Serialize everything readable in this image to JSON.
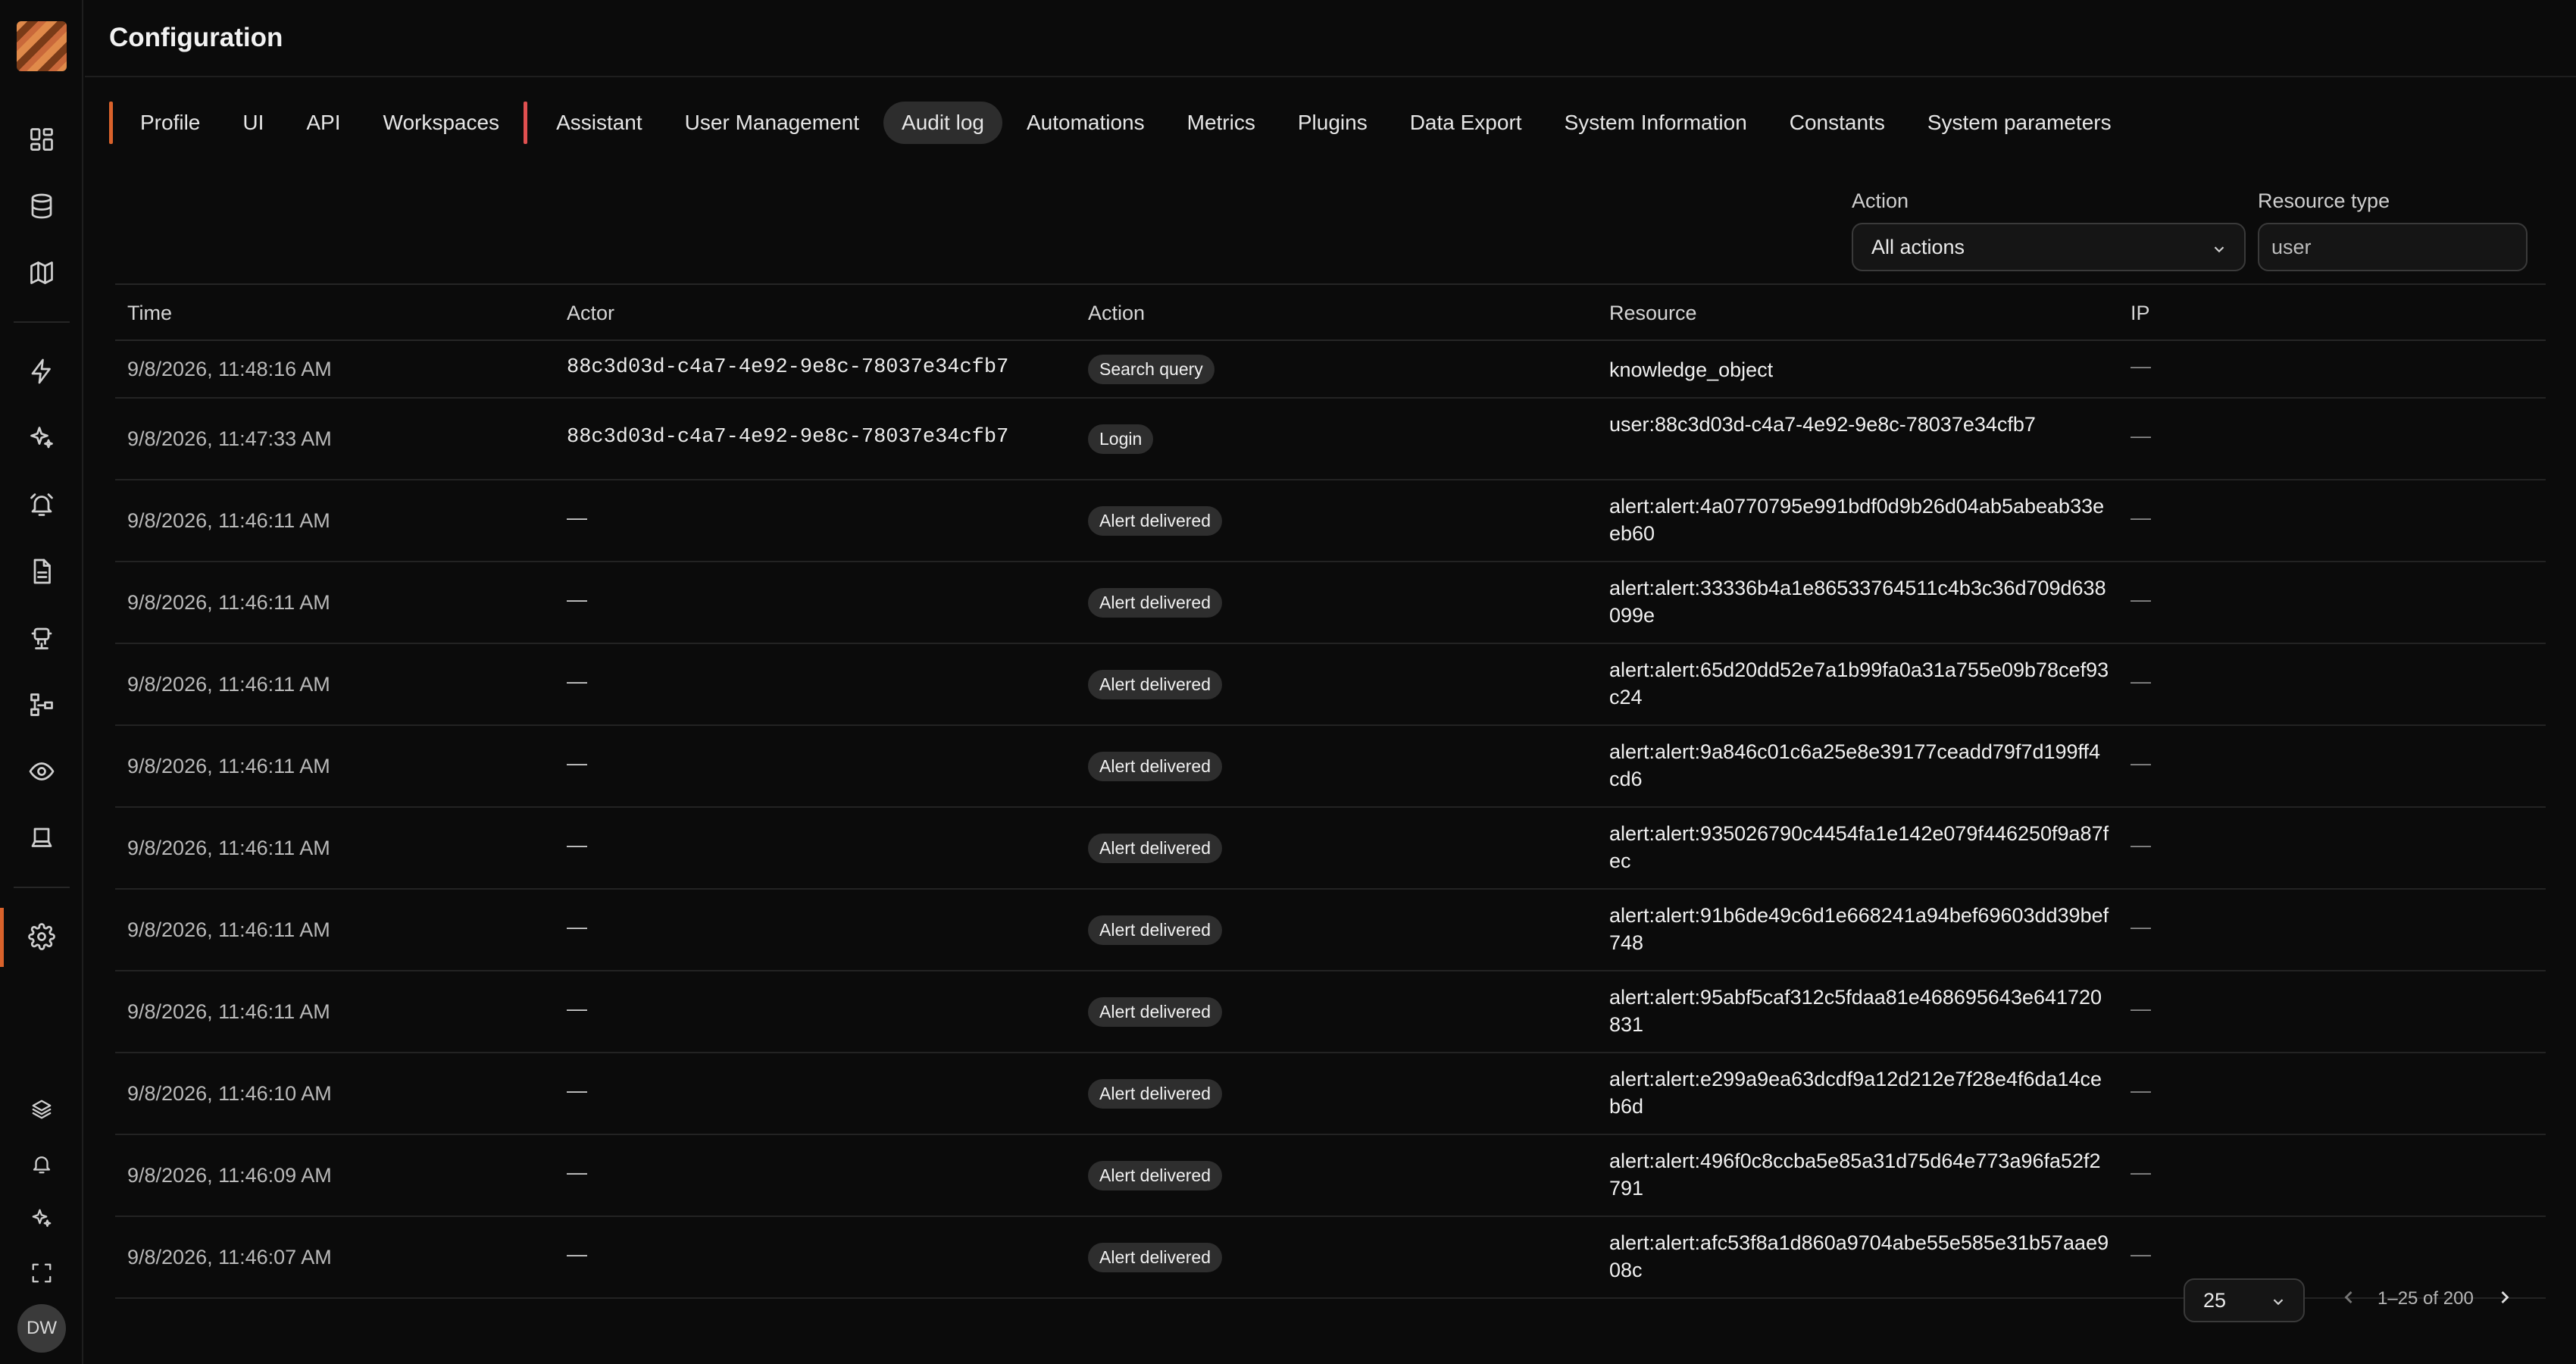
{
  "header": {
    "title": "Configuration"
  },
  "tabs": [
    {
      "label": "Profile"
    },
    {
      "label": "UI"
    },
    {
      "label": "API"
    },
    {
      "label": "Workspaces"
    },
    {
      "label": "Assistant"
    },
    {
      "label": "User Management"
    },
    {
      "label": "Audit log"
    },
    {
      "label": "Automations"
    },
    {
      "label": "Metrics"
    },
    {
      "label": "Plugins"
    },
    {
      "label": "Data Export"
    },
    {
      "label": "System Information"
    },
    {
      "label": "Constants"
    },
    {
      "label": "System parameters"
    }
  ],
  "active_tab": "Audit log",
  "filters": {
    "action_label": "Action",
    "action_value": "All actions",
    "resource_label": "Resource type",
    "resource_value": "user"
  },
  "table": {
    "headers": [
      "Time",
      "Actor",
      "Action",
      "Resource",
      "IP"
    ],
    "rows": [
      {
        "time": "9/8/2026, 11:48:16 AM",
        "actor": "88c3d03d-c4a7-4e92-9e8c-78037e34cfb7",
        "action": "Search query",
        "resource": "knowledge_object",
        "ip": "—"
      },
      {
        "time": "9/8/2026, 11:47:33 AM",
        "actor": "88c3d03d-c4a7-4e92-9e8c-78037e34cfb7",
        "action": "Login",
        "resource": "user:88c3d03d-c4a7-4e92-9e8c-78037e34cfb7",
        "ip": "—"
      },
      {
        "time": "9/8/2026, 11:46:11 AM",
        "actor": "—",
        "action": "Alert delivered",
        "resource": "alert:alert:4a0770795e991bdf0d9b26d04ab5abeab33eeb60",
        "ip": "—"
      },
      {
        "time": "9/8/2026, 11:46:11 AM",
        "actor": "—",
        "action": "Alert delivered",
        "resource": "alert:alert:33336b4a1e86533764511c4b3c36d709d638099e",
        "ip": "—"
      },
      {
        "time": "9/8/2026, 11:46:11 AM",
        "actor": "—",
        "action": "Alert delivered",
        "resource": "alert:alert:65d20dd52e7a1b99fa0a31a755e09b78cef93c24",
        "ip": "—"
      },
      {
        "time": "9/8/2026, 11:46:11 AM",
        "actor": "—",
        "action": "Alert delivered",
        "resource": "alert:alert:9a846c01c6a25e8e39177ceadd79f7d199ff4cd6",
        "ip": "—"
      },
      {
        "time": "9/8/2026, 11:46:11 AM",
        "actor": "—",
        "action": "Alert delivered",
        "resource": "alert:alert:935026790c4454fa1e142e079f446250f9a87fec",
        "ip": "—"
      },
      {
        "time": "9/8/2026, 11:46:11 AM",
        "actor": "—",
        "action": "Alert delivered",
        "resource": "alert:alert:91b6de49c6d1e668241a94bef69603dd39bef748",
        "ip": "—"
      },
      {
        "time": "9/8/2026, 11:46:11 AM",
        "actor": "—",
        "action": "Alert delivered",
        "resource": "alert:alert:95abf5caf312c5fdaa81e468695643e641720831",
        "ip": "—"
      },
      {
        "time": "9/8/2026, 11:46:10 AM",
        "actor": "—",
        "action": "Alert delivered",
        "resource": "alert:alert:e299a9ea63dcdf9a12d212e7f28e4f6da14ceb6d",
        "ip": "—"
      },
      {
        "time": "9/8/2026, 11:46:09 AM",
        "actor": "—",
        "action": "Alert delivered",
        "resource": "alert:alert:496f0c8ccba5e85a31d75d64e773a96fa52f2791",
        "ip": "—"
      },
      {
        "time": "9/8/2026, 11:46:07 AM",
        "actor": "—",
        "action": "Alert delivered",
        "resource": "alert:alert:afc53f8a1d860a9704abe55e585e31b57aae908c",
        "ip": "—"
      }
    ]
  },
  "pagination": {
    "page_size": "25",
    "range": "1–25 of 200"
  },
  "user": {
    "initials": "DW"
  },
  "icons": {
    "sidebar": [
      "dashboard-icon",
      "database-icon",
      "map-icon",
      "lightning-icon",
      "sparkle-icon",
      "alarm-bell-icon",
      "document-icon",
      "robot-icon",
      "flow-icon",
      "eye-icon",
      "monitor-icon",
      "settings-gear-icon",
      "layers-icon",
      "bell-icon",
      "sparkles-icon",
      "fullscreen-icon"
    ]
  },
  "colors": {
    "accent": "#d9622b",
    "separator": "#e05050",
    "background": "#0b0b0b"
  }
}
